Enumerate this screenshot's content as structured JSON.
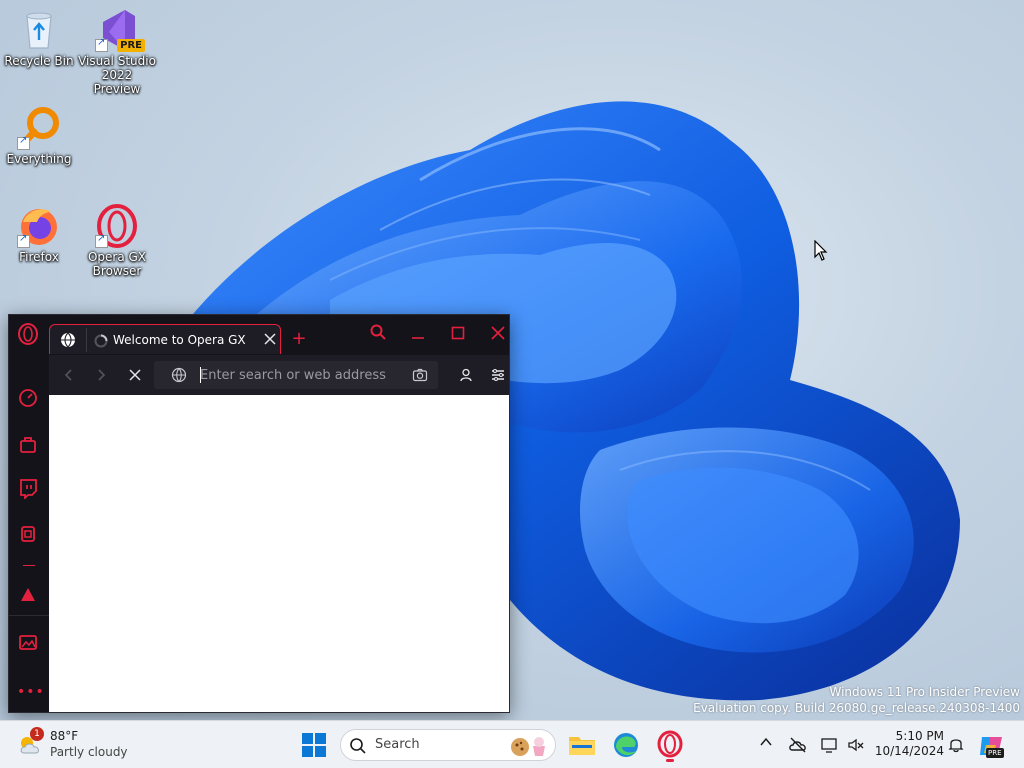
{
  "desktop": {
    "icons": [
      {
        "label": "Recycle Bin"
      },
      {
        "label": "Visual Studio 2022 Preview",
        "badge": "PRE"
      },
      {
        "label": "Everything"
      },
      {
        "label": "Firefox"
      },
      {
        "label": "Opera GX Browser"
      }
    ],
    "watermark": {
      "line1": "Windows 11 Pro Insider Preview",
      "line2": "Evaluation copy. Build 26080.ge_release.240308-1400"
    }
  },
  "opera": {
    "tab": {
      "title": "Welcome to Opera GX"
    },
    "address": {
      "placeholder": "Enter search or web address",
      "value": ""
    },
    "accent": "#e3213f",
    "sidebar_icons": [
      "opera-logo-icon",
      "speed-dial-icon",
      "shopping-bag-icon",
      "twitch-icon",
      "gx-control-icon",
      "gx-corner-icon",
      "gallery-icon",
      "more-icon"
    ]
  },
  "taskbar": {
    "weather": {
      "temp": "88°F",
      "condition": "Partly cloudy",
      "badge": "1"
    },
    "search": {
      "label": "Search"
    },
    "clock": {
      "time": "5:10 PM",
      "date": "10/14/2024"
    },
    "copilot_badge": "PRE"
  }
}
